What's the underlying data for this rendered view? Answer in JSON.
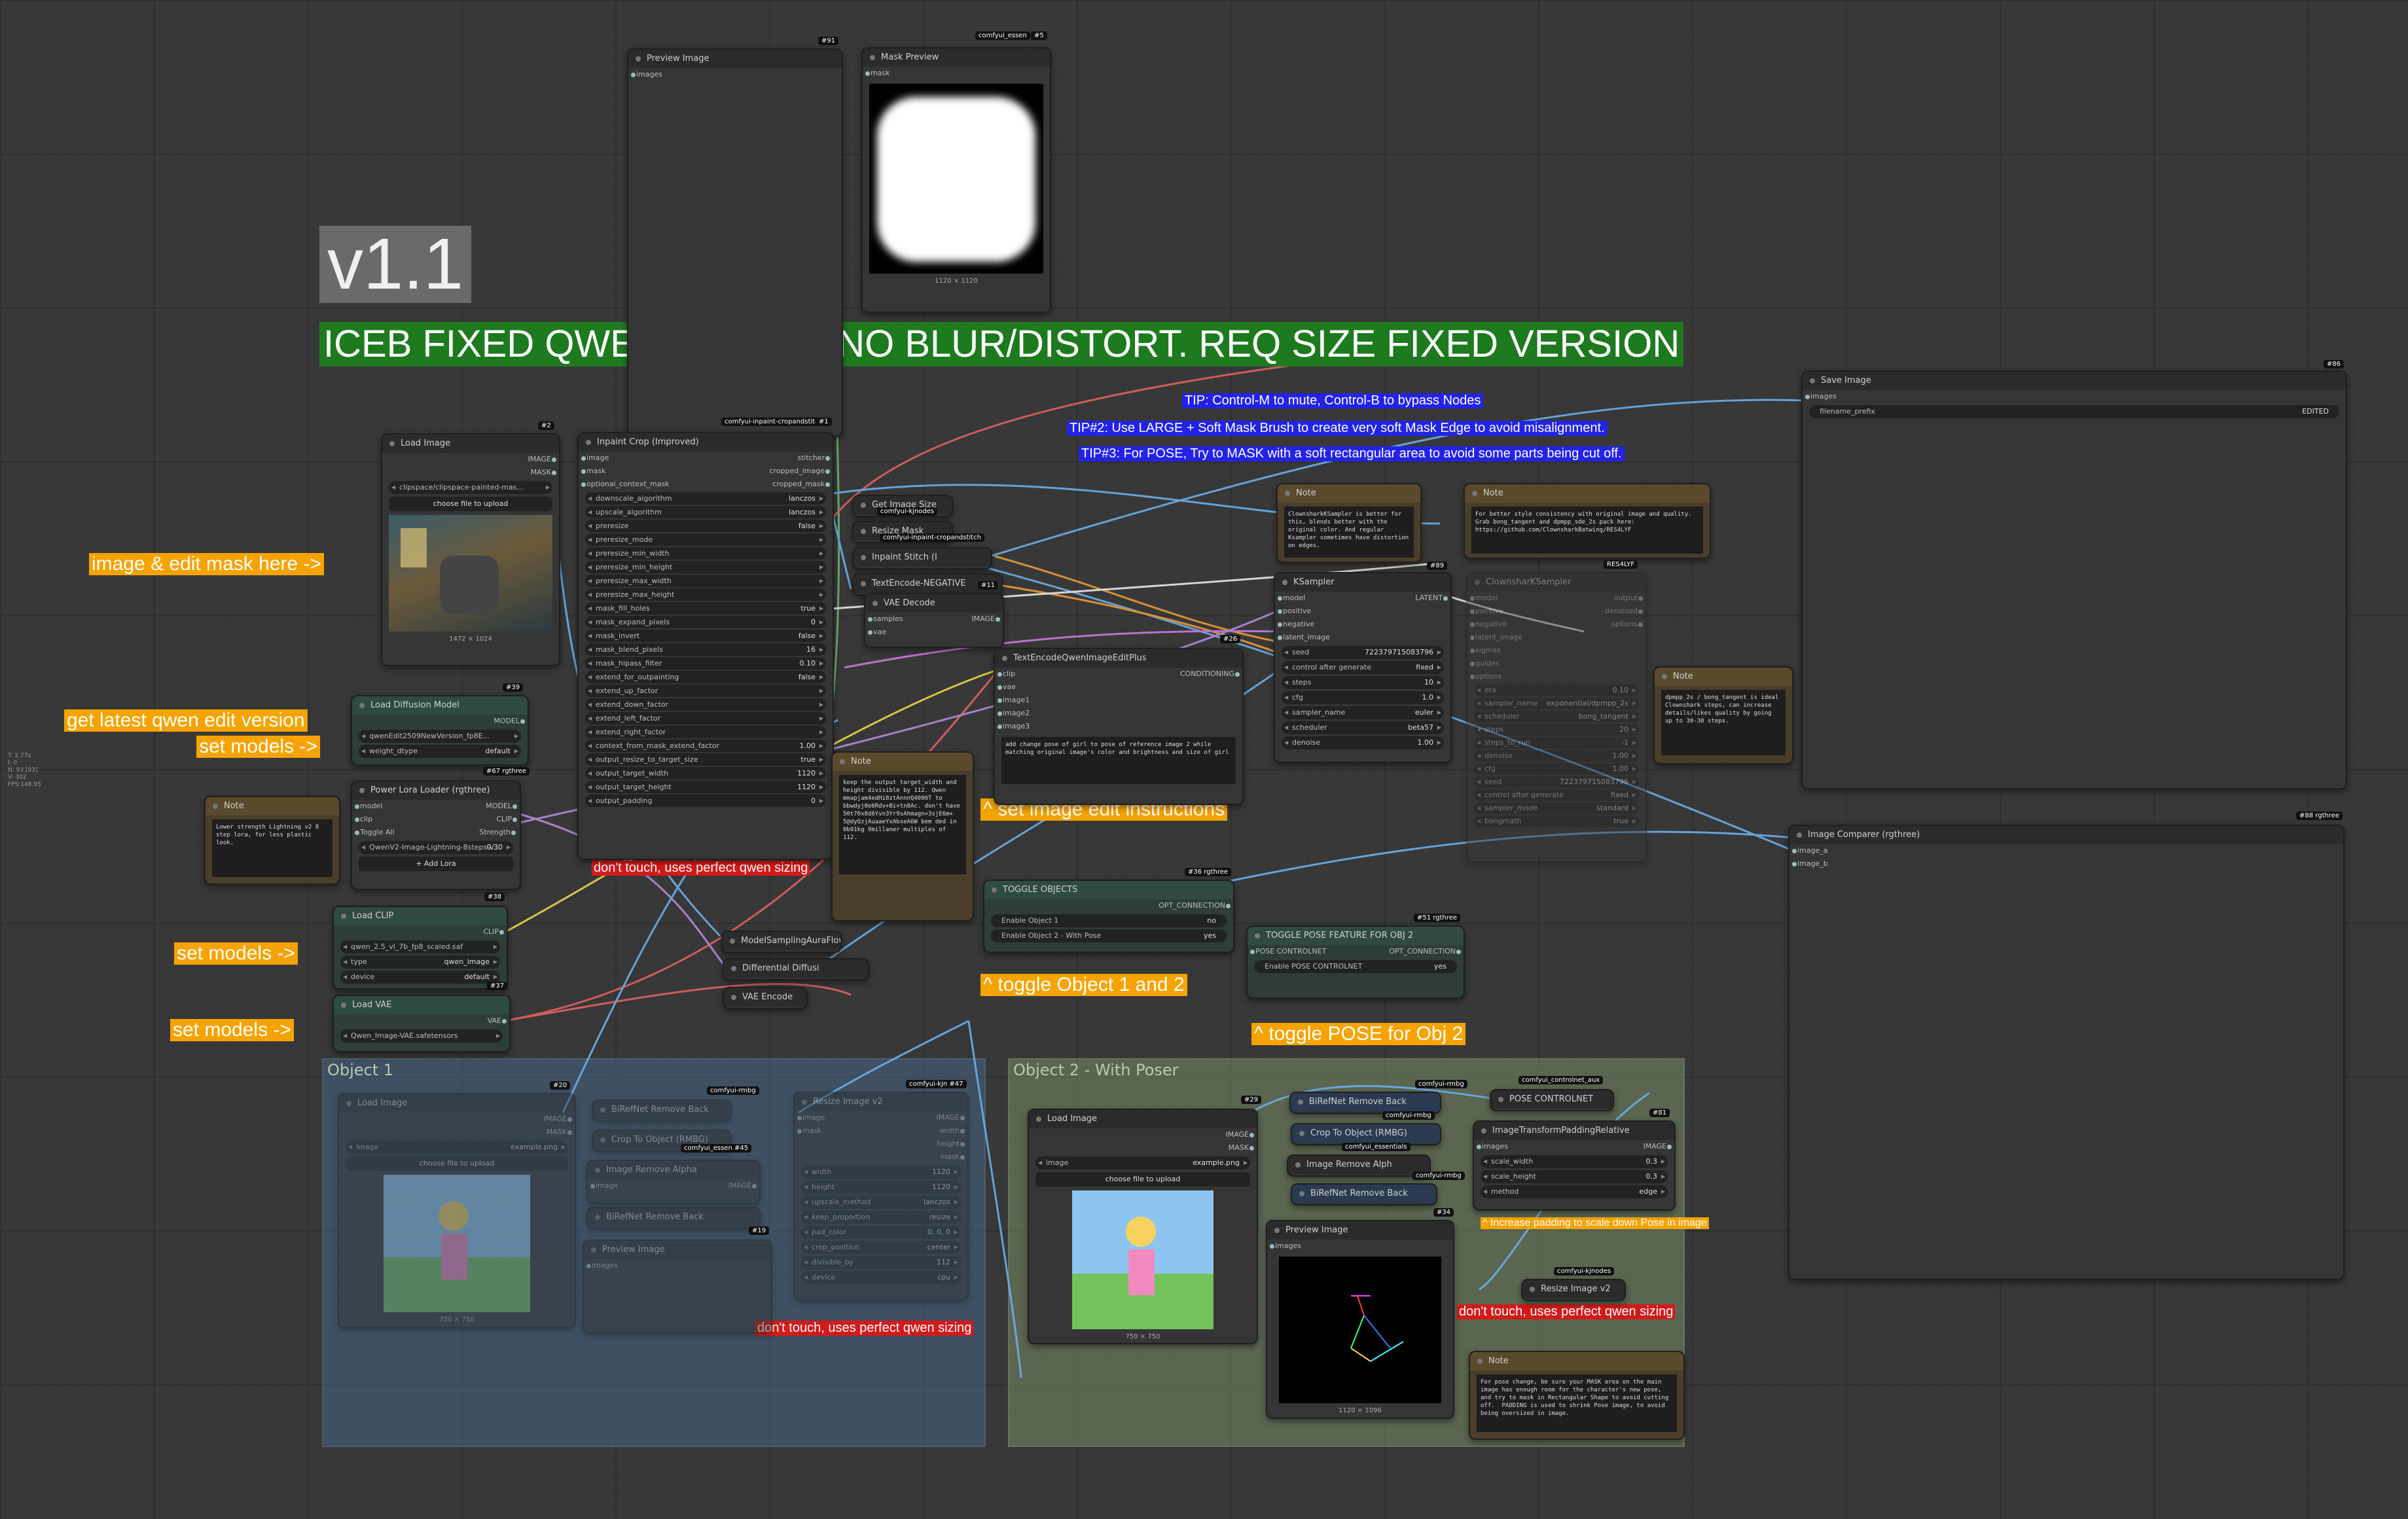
{
  "headline": {
    "version": "v1.1",
    "title": "ICEB FIXED QWEN EDITOR. NO BLUR/DISTORT.   REQ SIZE FIXED VERSION"
  },
  "tips": [
    "TIP:  Control-M to mute, Control-B to bypass Nodes",
    "TIP#2: Use LARGE + Soft Mask Brush to create very soft Mask Edge to avoid misalignment.",
    "TIP#3: For POSE, Try to MASK with a soft rectangular area to avoid some parts being cut off."
  ],
  "annotations": {
    "image_mask": "image & edit mask here ->",
    "latest_qwen": "get latest qwen edit version",
    "set_models_1": "set models ->",
    "set_models_2": "set models ->",
    "set_models_3": "set models ->",
    "dont_touch_1": "don't touch, uses perfect qwen sizing",
    "dont_touch_2": "don't touch, uses perfect qwen sizing",
    "dont_touch_3": "don't touch, uses perfect qwen sizing",
    "set_instructions": "^ set image edit instructions",
    "toggle_objects": "^ toggle Object 1 and 2",
    "toggle_pose": "^ toggle POSE for Obj 2",
    "increase_padding": "^ Increase padding to scale down Pose in image"
  },
  "groups": {
    "object1": "Object 1",
    "object2": "Object 2 - With Poser"
  },
  "sidebar_info": "T: 2.77s\nI: 0\nN: 93 [93]\nV: 302\nFPS:148.95",
  "nodes": {
    "preview_image_top": {
      "title": "Preview Image",
      "badge": "#91",
      "input": "images"
    },
    "mask_preview": {
      "title": "Mask Preview",
      "badge": "#5",
      "badge2": "comfyui_essen",
      "input": "mask",
      "caption": "1120 × 1120"
    },
    "save_image": {
      "title": "Save Image",
      "badge": "#86",
      "input": "images",
      "filename_key": "filename_prefix",
      "filename_val": "EDITED"
    },
    "load_image_main": {
      "title": "Load Image",
      "badge": "#2",
      "out1": "IMAGE",
      "out2": "MASK",
      "file": "clipspace/clipspace-painted-mas...",
      "upload": "choose file to upload",
      "caption": "1472 × 1024"
    },
    "inpaint_crop": {
      "title": "Inpaint Crop (Improved)",
      "badge": "#1",
      "badge2": "comfyui-inpaint-cropandstitch",
      "inputs": [
        "image",
        "mask",
        "optional_context_mask"
      ],
      "outputs": [
        "stitcher",
        "cropped_image",
        "cropped_mask"
      ],
      "widgets": [
        {
          "k": "downscale_algorithm",
          "v": "lanczos"
        },
        {
          "k": "upscale_algorithm",
          "v": "lanczos"
        },
        {
          "k": "preresize",
          "v": "false"
        },
        {
          "k": "preresize_mode",
          "v": ""
        },
        {
          "k": "preresize_min_width",
          "v": ""
        },
        {
          "k": "preresize_min_height",
          "v": ""
        },
        {
          "k": "preresize_max_width",
          "v": ""
        },
        {
          "k": "preresize_max_height",
          "v": ""
        },
        {
          "k": "mask_fill_holes",
          "v": "true"
        },
        {
          "k": "mask_expand_pixels",
          "v": "0"
        },
        {
          "k": "mask_invert",
          "v": "false"
        },
        {
          "k": "mask_blend_pixels",
          "v": "16"
        },
        {
          "k": "mask_hipass_filter",
          "v": "0.10"
        },
        {
          "k": "extend_for_outpainting",
          "v": "false"
        },
        {
          "k": "extend_up_factor",
          "v": ""
        },
        {
          "k": "extend_down_factor",
          "v": ""
        },
        {
          "k": "extend_left_factor",
          "v": ""
        },
        {
          "k": "extend_right_factor",
          "v": ""
        },
        {
          "k": "context_from_mask_extend_factor",
          "v": "1.00"
        },
        {
          "k": "output_resize_to_target_size",
          "v": "true"
        },
        {
          "k": "output_target_width",
          "v": "1120"
        },
        {
          "k": "output_target_height",
          "v": "1120"
        },
        {
          "k": "output_padding",
          "v": "0"
        }
      ]
    },
    "load_diffusion": {
      "title": "Load Diffusion Model",
      "badge": "#39",
      "out": "MODEL",
      "unet": "qwenEdit2509NewVersion_fp8E...",
      "dtype_k": "weight_dtype",
      "dtype_v": "default"
    },
    "lora_loader": {
      "title": "Power Lora Loader (rgthree)",
      "badge": "#67 rgthree",
      "in1": "model",
      "in2": "clip",
      "out1": "MODEL",
      "out2": "CLIP",
      "toggle": "Toggle All",
      "strength": "Strength",
      "lora": "QwenV2-Image-Lightning-8steps-V...",
      "lora_v": "0.30",
      "add": "+ Add Lora"
    },
    "note_lora": {
      "title": "Note",
      "text": "Lower strength Lightning v2 8 step lora, for less plastic look."
    },
    "load_clip": {
      "title": "Load CLIP",
      "badge": "#38",
      "out": "CLIP",
      "w1": "qwen_2.5_vl_7b_fp8_scaled.saf",
      "w2k": "type",
      "w2v": "qwen_image",
      "w3k": "device",
      "w3v": "default"
    },
    "load_vae": {
      "title": "Load VAE",
      "badge": "#37",
      "out": "VAE",
      "w1": "Qwen_Image-VAE.safetensors"
    },
    "get_image_size": {
      "title": "Get Image Size",
      "badge2": "comfyui-kjnodes"
    },
    "resize_mask": {
      "title": "Resize Mask",
      "badge2": "comfyui-inpaint-cropandstitch"
    },
    "inpaint_stitch": {
      "title": "Inpaint Stitch (I"
    },
    "textencode_neg": {
      "title": "TextEncode-NEGATIVE",
      "badge": "#11"
    },
    "vae_decode": {
      "title": "VAE Decode",
      "in1": "samples",
      "in2": "vae",
      "out": "IMAGE"
    },
    "note_main": {
      "title": "Note",
      "text": "keep the output target_width and height divisible by 112. Qwen mmapjam4edHi8ztAnnnQ4006T to bbwdyj0e6Rdv+Bi+tn8Ac. don't have 50t70x8d6Yvn3Yr9sAhmagn=3sjE6m+ 5@dyQzjAuaaeYxAbxeA6W bem ded in 0b01kg 9millaner multiples of 112."
    },
    "textencode_qwen": {
      "title": "TextEncodeQwenImageEditPlus",
      "badge": "#26",
      "inputs": [
        "clip",
        "vae",
        "image1",
        "image2",
        "image3"
      ],
      "out": "CONDITIONING",
      "prompt": "add change pose of girl to pose of reference image 2 while matching original image's color and brightness and size of girl"
    },
    "note_clownshark": {
      "title": "Note",
      "text": "ClownsharkKSampler is better for this, blends better with the original color. And regular Ksampler sometimes have distortion on edges."
    },
    "note_style": {
      "title": "Note",
      "text": "For better style consistency with original image and quality. Grab bong_tangent and dpmpp_sde_2s pack here: https://github.com/ClownsharkBatwing/RES4LYF"
    },
    "ksampler": {
      "title": "KSampler",
      "badge": "#89",
      "inputs": [
        "model",
        "positive",
        "negative",
        "latent_image"
      ],
      "out": "LATENT",
      "widgets": [
        {
          "k": "seed",
          "v": "722379715083796"
        },
        {
          "k": "control after generate",
          "v": "fixed"
        },
        {
          "k": "steps",
          "v": "10"
        },
        {
          "k": "cfg",
          "v": "1.0"
        },
        {
          "k": "sampler_name",
          "v": "euler"
        },
        {
          "k": "scheduler",
          "v": "beta57"
        },
        {
          "k": "denoise",
          "v": "1.00"
        }
      ]
    },
    "clownshark": {
      "title": "ClownsharKSampler",
      "badge": "RES4LYF",
      "inputs": [
        "model",
        "positive",
        "negative",
        "latent_image",
        "sigmas",
        "guides",
        "options"
      ],
      "outputs": [
        "output",
        "denoised",
        "options"
      ],
      "widgets": [
        {
          "k": "eta",
          "v": "0.10"
        },
        {
          "k": "sampler_name",
          "v": "exponential/dpmpp_2s"
        },
        {
          "k": "scheduler",
          "v": "bong_tangent"
        },
        {
          "k": "steps",
          "v": "20"
        },
        {
          "k": "steps_to_run",
          "v": "-1"
        },
        {
          "k": "denoise",
          "v": "1.00"
        },
        {
          "k": "cfg",
          "v": "1.00"
        },
        {
          "k": "seed",
          "v": "722379715083796"
        },
        {
          "k": "control after generate",
          "v": "fixed"
        },
        {
          "k": "sampler_mode",
          "v": "standard"
        },
        {
          "k": "bongmath",
          "v": "true"
        }
      ]
    },
    "note_steps": {
      "title": "Note",
      "text": "dpmpp_2s / bong_tangent is ideal Clownshark steps, can increase details/likes quality by going up to 30-30 steps."
    },
    "image_comparer": {
      "title": "Image Comparer (rgthree)",
      "badge": "#88 rgthree",
      "in1": "image_a",
      "in2": "image_b"
    },
    "model_sampling": {
      "title": "ModelSamplingAuraFlow"
    },
    "diff_diffusion": {
      "title": "Differential Diffusi"
    },
    "vae_encode": {
      "title": "VAE Encode"
    },
    "toggle_objects": {
      "title": "TOGGLE OBJECTS",
      "badge": "#36 rgthree",
      "out": "OPT_CONNECTION",
      "o1": "Enable Object 1",
      "o1v": "no",
      "o2": "Enable Object 2 - With Pose",
      "o2v": "yes"
    },
    "toggle_pose": {
      "title": "TOGGLE POSE FEATURE FOR OBJ 2",
      "badge": "#51 rgthree",
      "in": "POSE CONTROLNET",
      "out": "OPT_CONNECTION",
      "o1": "Enable POSE CONTROLNET",
      "o1v": "yes"
    },
    "obj1_load_image": {
      "title": "Load Image",
      "badge": "#20",
      "out1": "IMAGE",
      "out2": "MASK",
      "file_k": "image",
      "file_v": "example.png",
      "upload": "choose file to upload",
      "caption": "750 × 750"
    },
    "obj1_birefnet": {
      "title": "BiRefNet Remove Back",
      "badge2": "comfyui-rmbg"
    },
    "obj1_crop": {
      "title": "Crop To Object (RMBG)",
      "badge2": "comfyui_essen #45"
    },
    "obj1_remove_alpha": {
      "title": "Image Remove Alpha",
      "in": "image",
      "out": "IMAGE"
    },
    "obj1_birefnet2": {
      "title": "BiRefNet Remove Back",
      "badge": "#19"
    },
    "obj1_preview": {
      "title": "Preview Image",
      "in": "images"
    },
    "obj1_resize": {
      "title": "Resize Image v2",
      "badge2": "comfyui-kjn #47",
      "inputs": [
        "image",
        "mask"
      ],
      "outputs": [
        "IMAGE",
        "width",
        "height",
        "mask"
      ],
      "widgets": [
        {
          "k": "width",
          "v": "1120"
        },
        {
          "k": "height",
          "v": "1120"
        },
        {
          "k": "upscale_method",
          "v": "lanczos"
        },
        {
          "k": "keep_proportion",
          "v": "resize"
        },
        {
          "k": "pad_color",
          "v": "0, 0, 0"
        },
        {
          "k": "crop_position",
          "v": "center"
        },
        {
          "k": "divisible_by",
          "v": "112"
        },
        {
          "k": "device",
          "v": "cpu"
        }
      ]
    },
    "obj2_load_image": {
      "title": "Load Image",
      "badge": "#29",
      "out1": "IMAGE",
      "out2": "MASK",
      "file_k": "image",
      "file_v": "example.png",
      "upload": "choose file to upload",
      "caption": "750 × 750"
    },
    "obj2_birefnet": {
      "title": "BiRefNet Remove Back",
      "badge2": "comfyui-rmbg"
    },
    "obj2_crop": {
      "title": "Crop To Object (RMBG)",
      "badge2": "comfyui-rmbg"
    },
    "obj2_remove_alpha": {
      "title": "Image Remove Alph",
      "badge2": "comfyui_essentials"
    },
    "obj2_birefnet2": {
      "title": "BiRefNet Remove Back",
      "badge2": "comfyui-rmbg"
    },
    "obj2_preview": {
      "title": "Preview Image",
      "badge": "#34",
      "in": "images",
      "caption": "1120 × 1096"
    },
    "pose_controlnet": {
      "title": "POSE CONTROLNET",
      "badge2": "comfyui_controlnet_aux"
    },
    "image_padding": {
      "title": "ImageTransformPaddingRelative",
      "badge": "#81",
      "in": "images",
      "out": "IMAGE",
      "widgets": [
        {
          "k": "scale_width",
          "v": "0.3"
        },
        {
          "k": "scale_height",
          "v": "0.3"
        },
        {
          "k": "method",
          "v": "edge"
        }
      ]
    },
    "obj2_resize": {
      "title": "Resize Image v2",
      "badge2": "comfyui-kjnodes"
    },
    "note_pose": {
      "title": "Note",
      "text": "For pose change, be sure your MASK area on the main image has enough room for the character's new pose, and try to mask in Rectangular Shape to avoid cutting off.  PADDING is used to shrink Pose image, to avoid being oversized in image."
    }
  },
  "colors": {
    "canvas": "#383838",
    "headline_bg": "#1e7a1e",
    "annotation_orange": "#f5a300",
    "annotation_red": "#d21a1a",
    "tip_blue": "#2323e8",
    "group_blue": "#3d5a7a",
    "group_green": "#6b7d5e"
  }
}
